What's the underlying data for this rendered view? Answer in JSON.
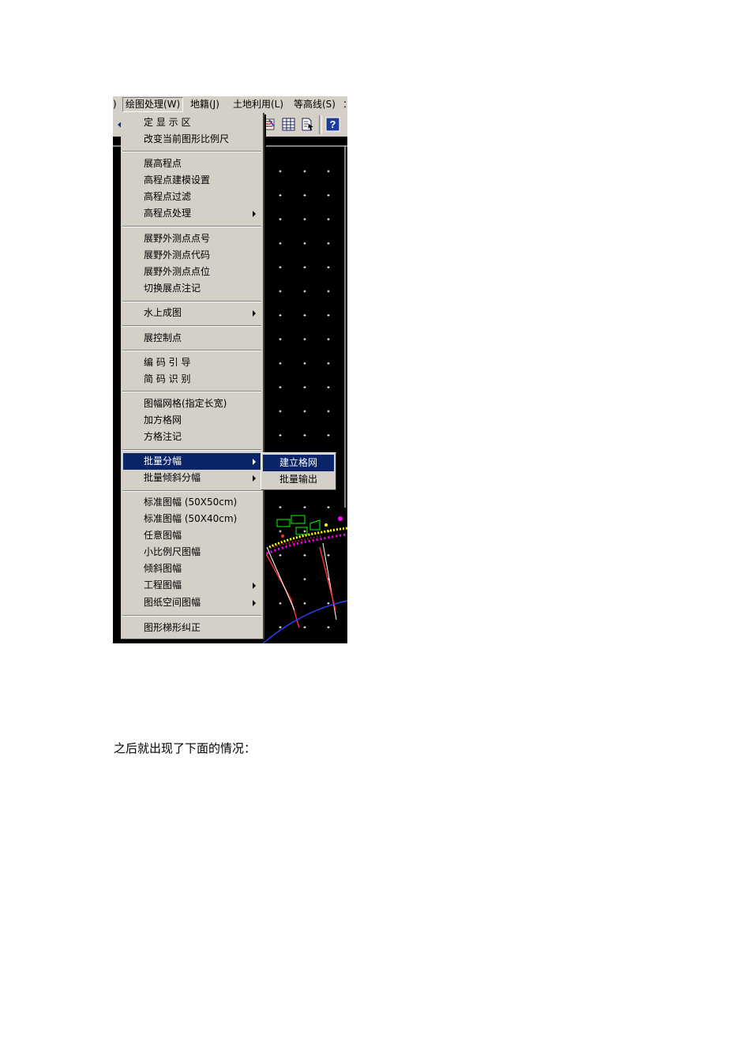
{
  "menubar": {
    "items": [
      {
        "label": ")"
      },
      {
        "label": "绘图处理(W)"
      },
      {
        "label": "地籍(J)"
      },
      {
        "label": "土地利用(L)"
      },
      {
        "label": "等高线(S)"
      },
      {
        "label": "："
      }
    ]
  },
  "toolbar": {
    "icons": [
      "arrow-icon",
      "properties-icon",
      "grid-icon",
      "document-arrow-icon",
      "help-icon"
    ],
    "help_glyph": "?"
  },
  "dropdown": {
    "items": [
      {
        "label": "定 显 示 区",
        "has_submenu": false
      },
      {
        "label": "改变当前图形比例尺",
        "has_submenu": false
      },
      {
        "label": "展高程点",
        "has_submenu": false
      },
      {
        "label": "高程点建模设置",
        "has_submenu": false
      },
      {
        "label": "高程点过滤",
        "has_submenu": false
      },
      {
        "label": "高程点处理",
        "has_submenu": true
      },
      {
        "label": "展野外测点点号",
        "has_submenu": false
      },
      {
        "label": "展野外测点代码",
        "has_submenu": false
      },
      {
        "label": "展野外测点点位",
        "has_submenu": false
      },
      {
        "label": "切换展点注记",
        "has_submenu": false
      },
      {
        "label": "水上成图",
        "has_submenu": true
      },
      {
        "label": "展控制点",
        "has_submenu": false
      },
      {
        "label": "编 码 引 导",
        "has_submenu": false
      },
      {
        "label": "简 码 识 别",
        "has_submenu": false
      },
      {
        "label": "图幅网格(指定长宽)",
        "has_submenu": false
      },
      {
        "label": "加方格网",
        "has_submenu": false
      },
      {
        "label": "方格注记",
        "has_submenu": false
      },
      {
        "label": "批量分幅",
        "has_submenu": true,
        "highlighted": true
      },
      {
        "label": "批量倾斜分幅",
        "has_submenu": true
      },
      {
        "label": "标准图幅 (50X50cm)",
        "has_submenu": false
      },
      {
        "label": "标准图幅 (50X40cm)",
        "has_submenu": false
      },
      {
        "label": "任意图幅",
        "has_submenu": false
      },
      {
        "label": "小比例尺图幅",
        "has_submenu": false
      },
      {
        "label": "倾斜图幅",
        "has_submenu": false
      },
      {
        "label": "工程图幅",
        "has_submenu": true
      },
      {
        "label": "图纸空间图幅",
        "has_submenu": true
      },
      {
        "label": "图形梯形纠正",
        "has_submenu": false
      }
    ]
  },
  "submenu": {
    "items": [
      {
        "label": "建立格网",
        "highlighted": true
      },
      {
        "label": "批量输出",
        "highlighted": false
      }
    ]
  },
  "caption": "之后就出现了下面的情况：",
  "colors": {
    "menu_bg": "#d4d0c8",
    "highlight": "#0a246a",
    "canvas_bg": "#000000",
    "grid_mark": "#ffffff",
    "drawing_green": "#00ff00",
    "drawing_magenta": "#ff00ff",
    "drawing_red": "#ff3030",
    "drawing_yellow": "#ffff00",
    "drawing_blue": "#3040ff"
  }
}
